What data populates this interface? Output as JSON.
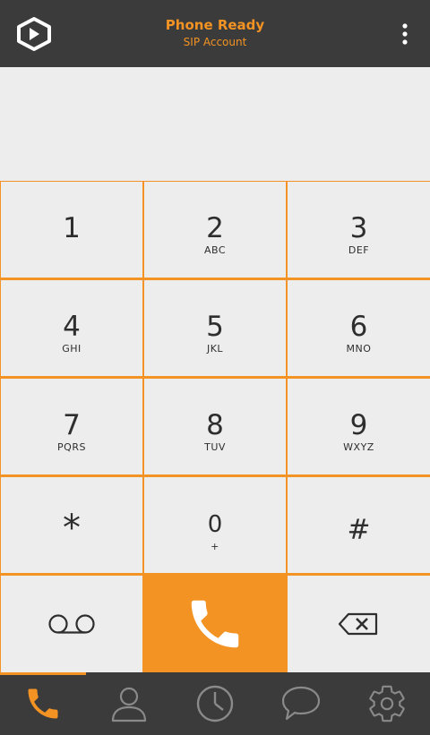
{
  "header": {
    "title": "Phone Ready",
    "subtitle": "SIP Account",
    "logo_icon": "cube-logo-icon",
    "menu_icon": "overflow-menu-icon"
  },
  "dialpad": {
    "keys": [
      {
        "digit": "1",
        "letters": ""
      },
      {
        "digit": "2",
        "letters": "ABC"
      },
      {
        "digit": "3",
        "letters": "DEF"
      },
      {
        "digit": "4",
        "letters": "GHI"
      },
      {
        "digit": "5",
        "letters": "JKL"
      },
      {
        "digit": "6",
        "letters": "MNO"
      },
      {
        "digit": "7",
        "letters": "PQRS"
      },
      {
        "digit": "8",
        "letters": "TUV"
      },
      {
        "digit": "9",
        "letters": "WXYZ"
      },
      {
        "digit": "*",
        "letters": ""
      },
      {
        "digit": "0",
        "letters": "+"
      },
      {
        "digit": "#",
        "letters": ""
      }
    ],
    "bottom_row_icons": [
      "voicemail-icon",
      "call-icon",
      "backspace-icon"
    ]
  },
  "tabs": [
    {
      "icon": "phone-icon",
      "active": true
    },
    {
      "icon": "contacts-icon",
      "active": false
    },
    {
      "icon": "history-clock-icon",
      "active": false
    },
    {
      "icon": "chat-bubble-icon",
      "active": false
    },
    {
      "icon": "settings-gear-icon",
      "active": false
    }
  ],
  "colors": {
    "accent": "#f39323",
    "bar": "#3b3b3b",
    "key_bg": "#ededed",
    "text": "#2e2e2e",
    "inactive_icon": "#8a8a8a"
  }
}
